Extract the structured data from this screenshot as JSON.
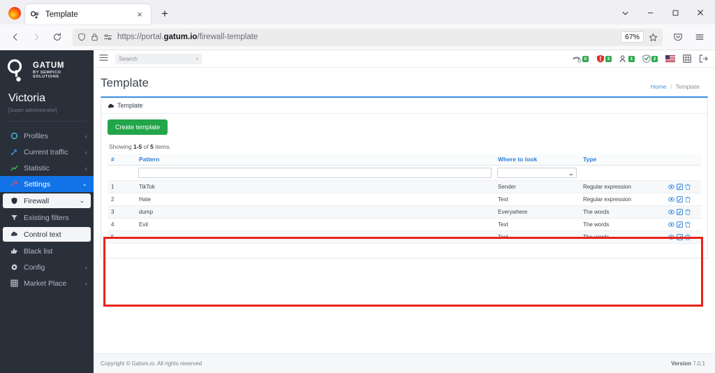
{
  "browser": {
    "tab": {
      "title": "Template",
      "favicon": "gatum-favicon",
      "close": "×"
    },
    "new_tab": "+",
    "window_controls": {
      "list_all_tabs": "chevron-down-icon",
      "minimize": "—",
      "maximize": "□",
      "close": "×"
    },
    "nav": {
      "back": "←",
      "forward": "→",
      "reload": "↻"
    },
    "url": {
      "prefix": "https://portal.",
      "domain": "gatum.io",
      "path": "/firewall-template"
    },
    "zoom_level": "67%",
    "icons": {
      "shield": "shield-icon",
      "lock": "lock-icon",
      "permissions": "permissions-icon",
      "bookmark": "star-icon",
      "pocket": "save-to-pocket-icon",
      "menu": "app-menu-icon"
    }
  },
  "sidebar": {
    "brand": {
      "name": "GATUM",
      "sub": "BY SEMPICO SOLUTIONS"
    },
    "user": {
      "name": "Victoria",
      "role": "[Super administrator]"
    },
    "items": [
      {
        "label": "Profiles",
        "icon": "profiles-icon",
        "caret": "‹",
        "state": "normal"
      },
      {
        "label": "Current traffic",
        "icon": "traffic-icon",
        "caret": "‹",
        "state": "normal"
      },
      {
        "label": "Statistic",
        "icon": "statistic-icon",
        "caret": "‹",
        "state": "normal"
      },
      {
        "label": "Settings",
        "icon": "settings-icon",
        "caret": "⌄",
        "state": "active"
      },
      {
        "label": "Firewall",
        "icon": "shield-icon",
        "caret": "⌄",
        "state": "sub-open"
      },
      {
        "label": "Existing filters",
        "icon": "filter-icon",
        "caret": "",
        "state": "sub"
      },
      {
        "label": "Control text",
        "icon": "control-text-icon",
        "caret": "",
        "state": "sub-sel"
      },
      {
        "label": "Black list",
        "icon": "black-list-icon",
        "caret": "",
        "state": "sub"
      },
      {
        "label": "Config",
        "icon": "gear-icon",
        "caret": "‹",
        "state": "sub"
      },
      {
        "label": "Market Place",
        "icon": "grid-icon",
        "caret": "‹",
        "state": "sub"
      }
    ]
  },
  "topbar": {
    "hamburger": "hamburger-icon",
    "search": {
      "placeholder": "Search",
      "value": ""
    },
    "status_icons": [
      {
        "name": "phone-icon",
        "badge": "0",
        "badge_color": "#2fa84f"
      },
      {
        "name": "alert-shield-icon",
        "badge": "3",
        "badge_color": "#2fa84f"
      },
      {
        "name": "users-icon",
        "badge": "1",
        "badge_color": "#2fa84f"
      },
      {
        "name": "check-shield-icon",
        "badge": "2",
        "badge_color": "#2fa84f"
      }
    ],
    "language_flag": "us-flag-icon",
    "apps_icon": "grid-icon",
    "logout_icon": "logout-icon"
  },
  "main": {
    "title": "Template",
    "breadcrumb": {
      "home": "Home",
      "separator": "/",
      "current": "Template"
    },
    "panel": {
      "header_icon": "cloud-upload-icon",
      "header_label": "Template"
    },
    "create_button": "Create template",
    "showing": {
      "prefix": "Showing ",
      "range": "1-5",
      "mid": " of ",
      "total": "5",
      "suffix": " items."
    },
    "table": {
      "columns": [
        "#",
        "Pattern",
        "Where to look",
        "Type",
        ""
      ],
      "filters": {
        "pattern": "",
        "where_to_look": "",
        "type": ""
      },
      "rows": [
        {
          "num": "1",
          "pattern": "TikTok",
          "where": "Sender",
          "type": "Regular expression"
        },
        {
          "num": "2",
          "pattern": "Hate",
          "where": "Text",
          "type": "Regular expression"
        },
        {
          "num": "3",
          "pattern": "dump",
          "where": "Everywhere",
          "type": "The words"
        },
        {
          "num": "4",
          "pattern": "Evil",
          "where": "Text",
          "type": "The words"
        },
        {
          "num": "5",
          "pattern": "",
          "where": "Text",
          "type": "The words"
        }
      ],
      "row_actions": [
        "view-icon",
        "edit-icon",
        "delete-icon"
      ]
    },
    "highlight_color": "#e8231b"
  },
  "footer": {
    "copyright": "Copyright © Gatum.io. All rights reserved",
    "version_label": "Version",
    "version_value": "7.0.1"
  }
}
